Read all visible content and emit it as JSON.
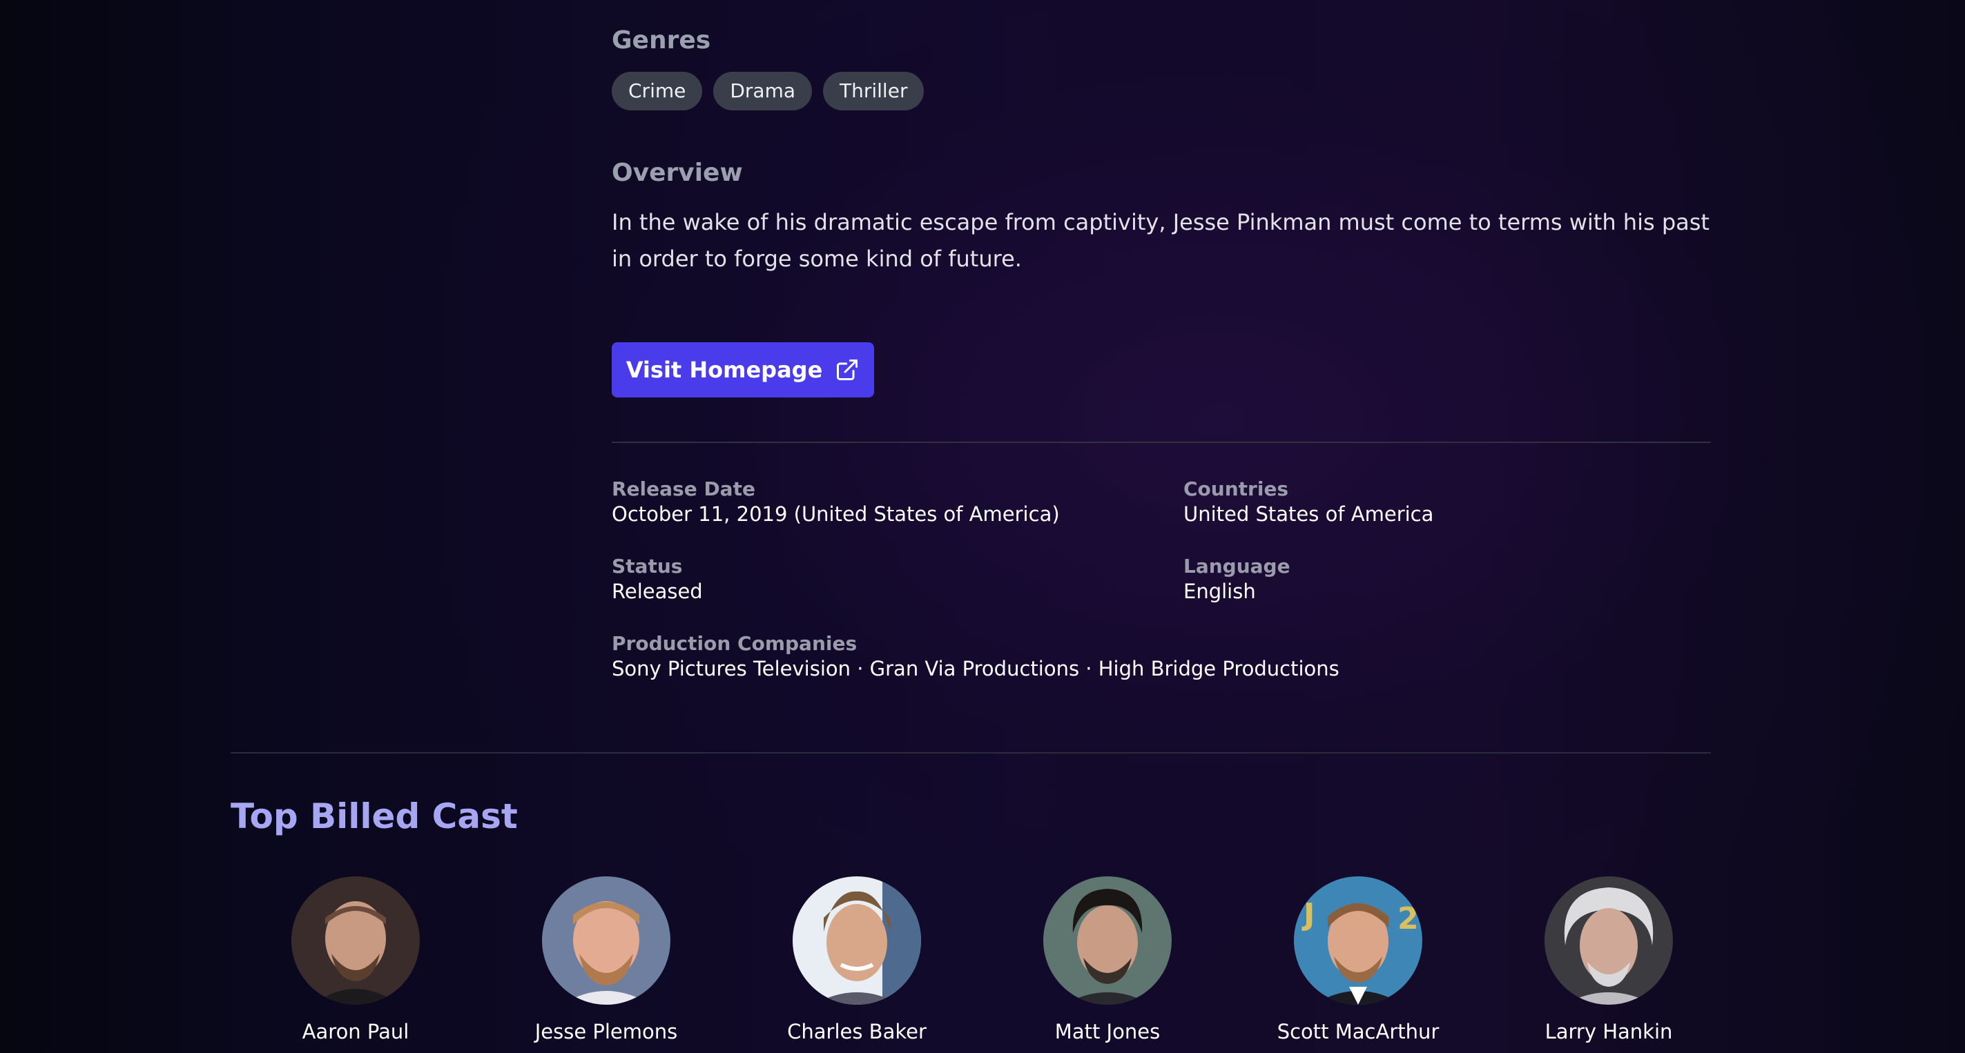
{
  "genres": {
    "heading": "Genres",
    "items": [
      "Crime",
      "Drama",
      "Thriller"
    ]
  },
  "overview": {
    "heading": "Overview",
    "text": "In the wake of his dramatic escape from captivity, Jesse Pinkman must come to terms with his past in order to forge some kind of future."
  },
  "homepage": {
    "label": "Visit Homepage",
    "icon": "external-link-icon"
  },
  "info": {
    "release_date": {
      "label": "Release Date",
      "value": "October 11, 2019 (United States of America)"
    },
    "countries": {
      "label": "Countries",
      "value": "United States of America"
    },
    "status": {
      "label": "Status",
      "value": "Released"
    },
    "language": {
      "label": "Language",
      "value": "English"
    },
    "production_companies": {
      "label": "Production Companies",
      "value": "Sony Pictures Television · Gran Via Productions · High Bridge Productions"
    }
  },
  "cast": {
    "heading": "Top Billed Cast",
    "members": [
      {
        "name": "Aaron Paul"
      },
      {
        "name": "Jesse Plemons"
      },
      {
        "name": "Charles Baker"
      },
      {
        "name": "Matt Jones"
      },
      {
        "name": "Scott MacArthur"
      },
      {
        "name": "Larry Hankin"
      }
    ]
  },
  "colors": {
    "accent": "#4a3cea",
    "cast_heading": "#a7a6f2",
    "pill_bg": "#3a3e4a",
    "muted_label": "#9a9cab"
  }
}
